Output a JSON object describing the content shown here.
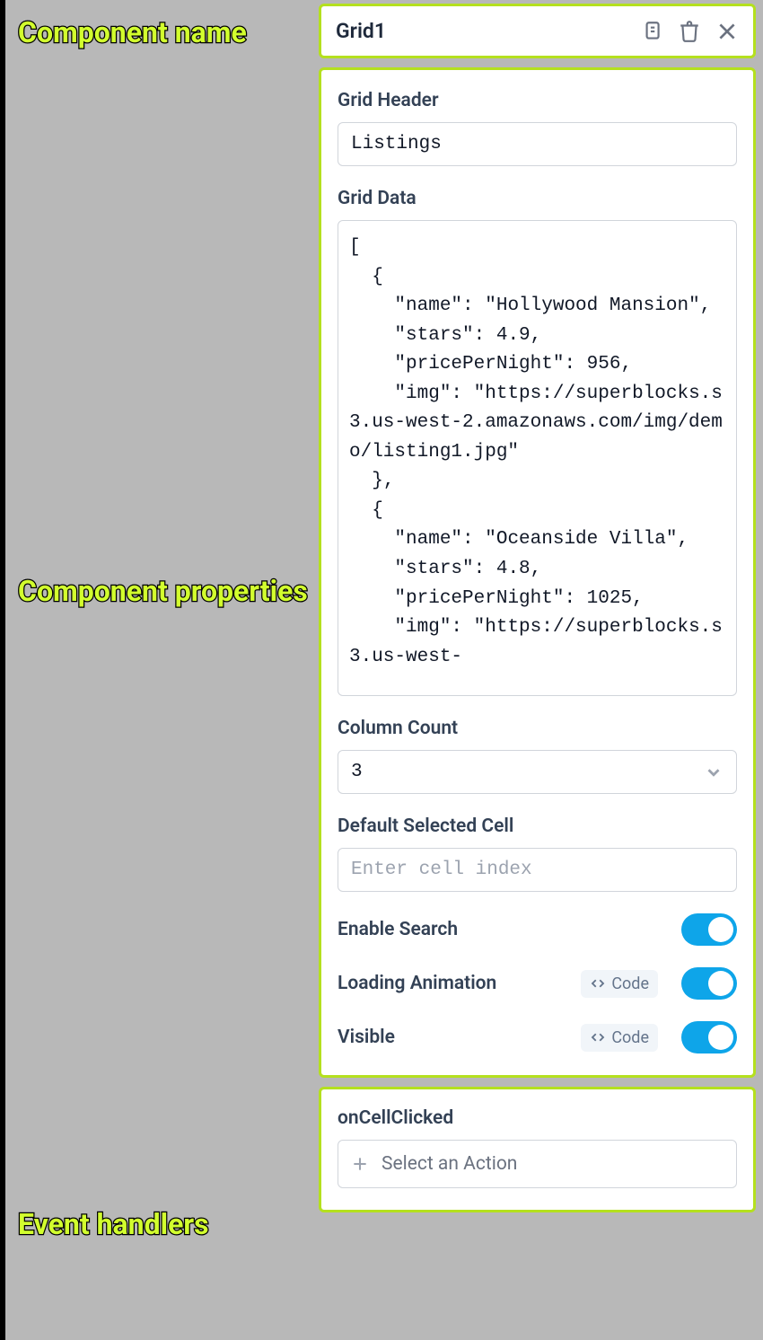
{
  "annotations": {
    "component_name": "Component name",
    "component_properties": "Component\nproperties",
    "event_handlers": "Event handlers"
  },
  "header": {
    "title": "Grid1",
    "icons": {
      "copy": "copy-icon",
      "delete": "delete-icon",
      "close": "close-icon"
    }
  },
  "properties": {
    "grid_header": {
      "label": "Grid Header",
      "value": "Listings"
    },
    "grid_data": {
      "label": "Grid Data",
      "value": "[\n  {\n    \"name\": \"Hollywood Mansion\",\n    \"stars\": 4.9,\n    \"pricePerNight\": 956,\n    \"img\": \"https://superblocks.s3.us-west-2.amazonaws.com/img/demo/listing1.jpg\"\n  },\n  {\n    \"name\": \"Oceanside Villa\",\n    \"stars\": 4.8,\n    \"pricePerNight\": 1025,\n    \"img\": \"https://superblocks.s3.us-west-"
    },
    "column_count": {
      "label": "Column Count",
      "value": "3"
    },
    "default_selected_cell": {
      "label": "Default Selected Cell",
      "placeholder": "Enter cell index"
    },
    "enable_search": {
      "label": "Enable Search",
      "value": true
    },
    "loading_animation": {
      "label": "Loading Animation",
      "code_toggle_label": "Code",
      "value": true
    },
    "visible": {
      "label": "Visible",
      "code_toggle_label": "Code",
      "value": true
    }
  },
  "events": {
    "on_cell_clicked": {
      "label": "onCellClicked",
      "action_placeholder": "Select an Action"
    }
  }
}
